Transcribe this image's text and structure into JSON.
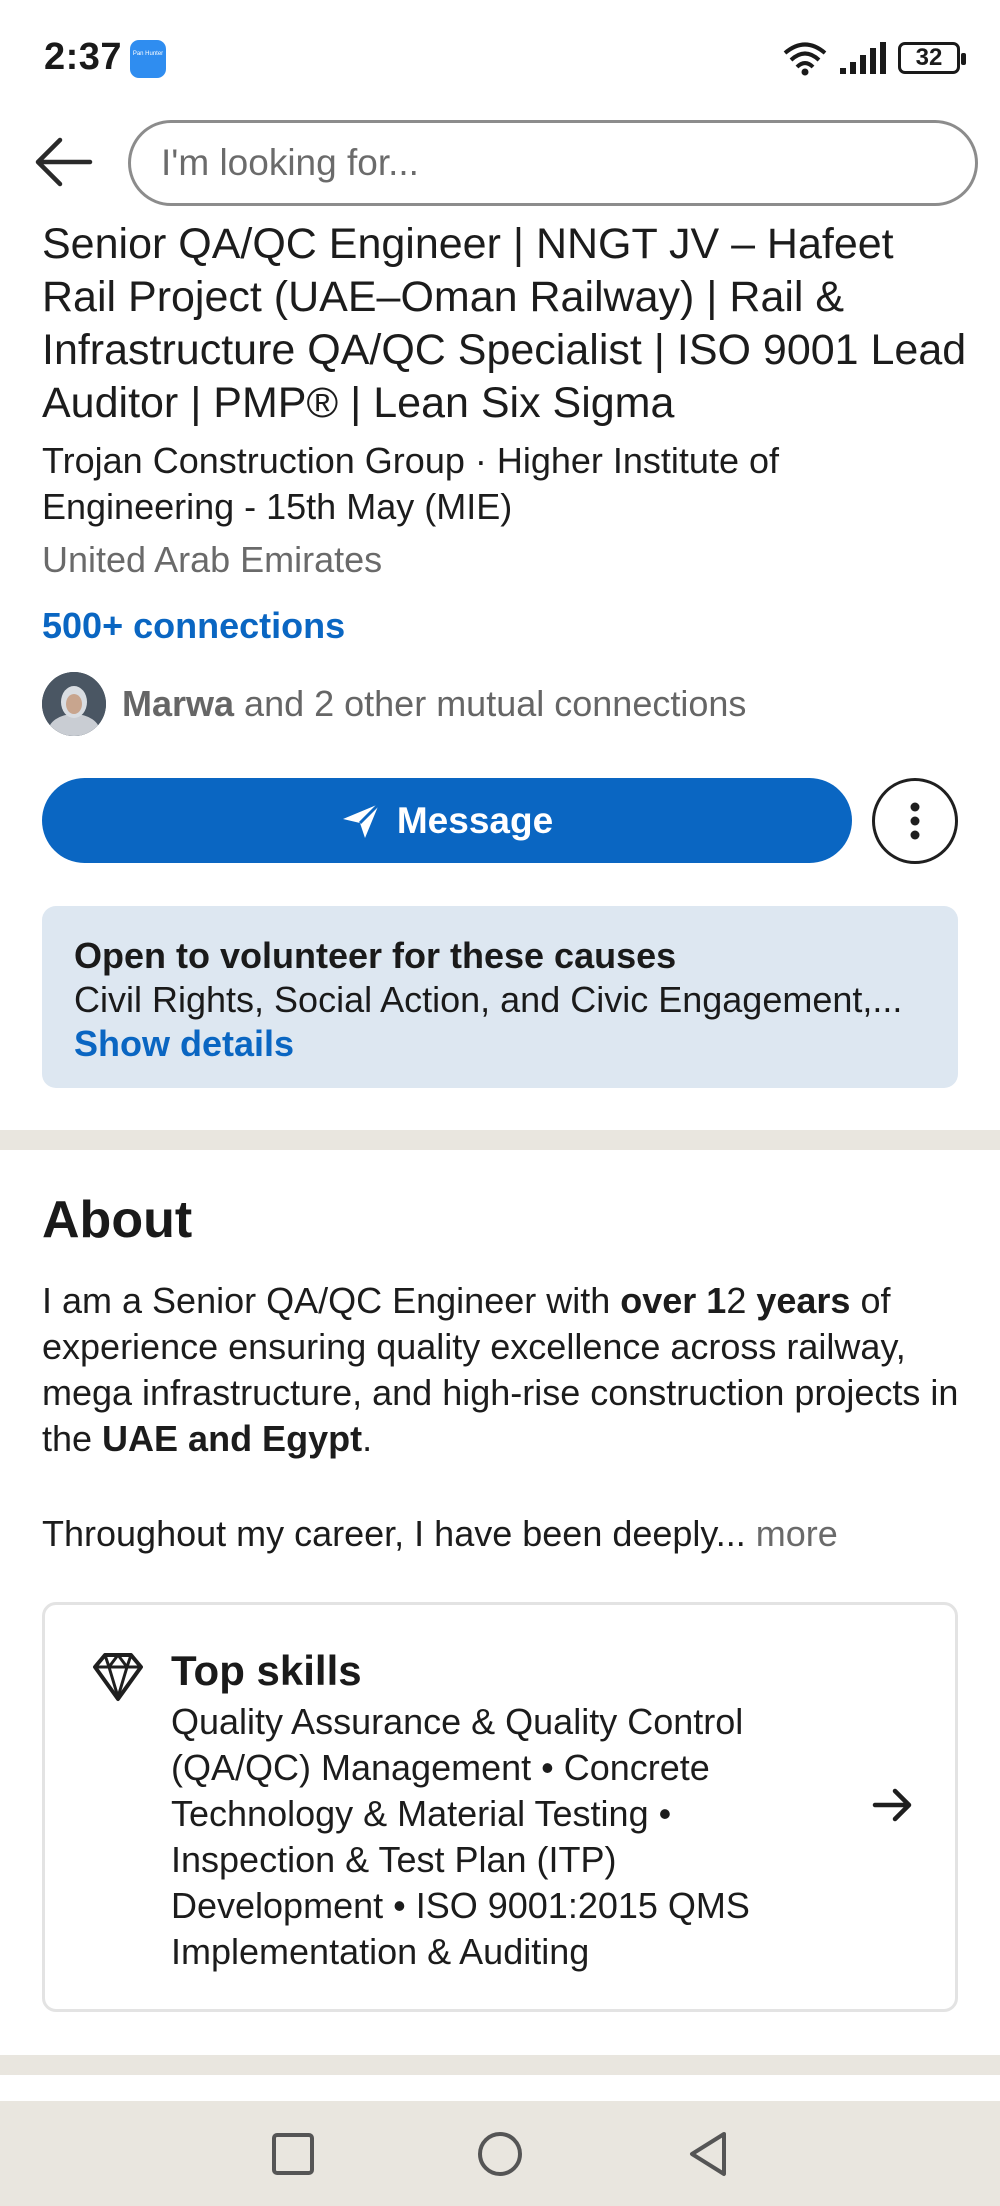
{
  "status_bar": {
    "time": "2:37",
    "app_badge": "Pan Hunter",
    "battery": "32"
  },
  "search": {
    "placeholder": "I'm looking for..."
  },
  "profile": {
    "headline": "Senior QA/QC Engineer | NNGT JV – Hafeet Rail Project (UAE–Oman Railway) | Rail & Infrastructure QA/QC Specialist | ISO 9001 Lead Auditor | PMP® | Lean Six Sigma",
    "subline": "Trojan Construction Group · Higher Institute of Engineering - 15th May (MIE)",
    "location": "United Arab Emirates",
    "connections": "500+ connections",
    "mutual_name": "Marwa",
    "mutual_rest": " and 2 other mutual connections"
  },
  "actions": {
    "message_label": "Message"
  },
  "volunteer": {
    "title": "Open to volunteer for these causes",
    "causes": "Civil Rights, Social Action, and Civic Engagement,...",
    "link": "Show details"
  },
  "about": {
    "heading": "About",
    "p1_a": "I am a Senior QA/QC Engineer with ",
    "p1_b": "over 1",
    "p1_c": "2 ",
    "p1_d": "years",
    "p1_e": " of experience ensuring quality excellence across railway, mega infrastructure, and high-rise construction projects in the ",
    "p1_f": "UAE and Egypt",
    "p1_g": ".",
    "p2": "Throughout my career, I have been deeply...",
    "more_label": " more"
  },
  "top_skills": {
    "title": "Top skills",
    "list": "Quality Assurance & Quality Control (QA/QC) Management • Concrete Technology & Material Testing • Inspection & Test Plan (ITP) Development • ISO 9001:2015 QMS Implementation & Auditing"
  },
  "icons": {
    "back": "arrow-left-icon",
    "send": "send-icon",
    "more": "vertical-ellipsis-icon",
    "diamond": "diamond-icon",
    "arrow": "arrow-right-icon",
    "wifi": "wifi-icon",
    "signal": "signal-icon"
  },
  "colors": {
    "accent": "#0a66c2",
    "card_bg": "#dde7f1",
    "divider": "#e9e6df"
  }
}
